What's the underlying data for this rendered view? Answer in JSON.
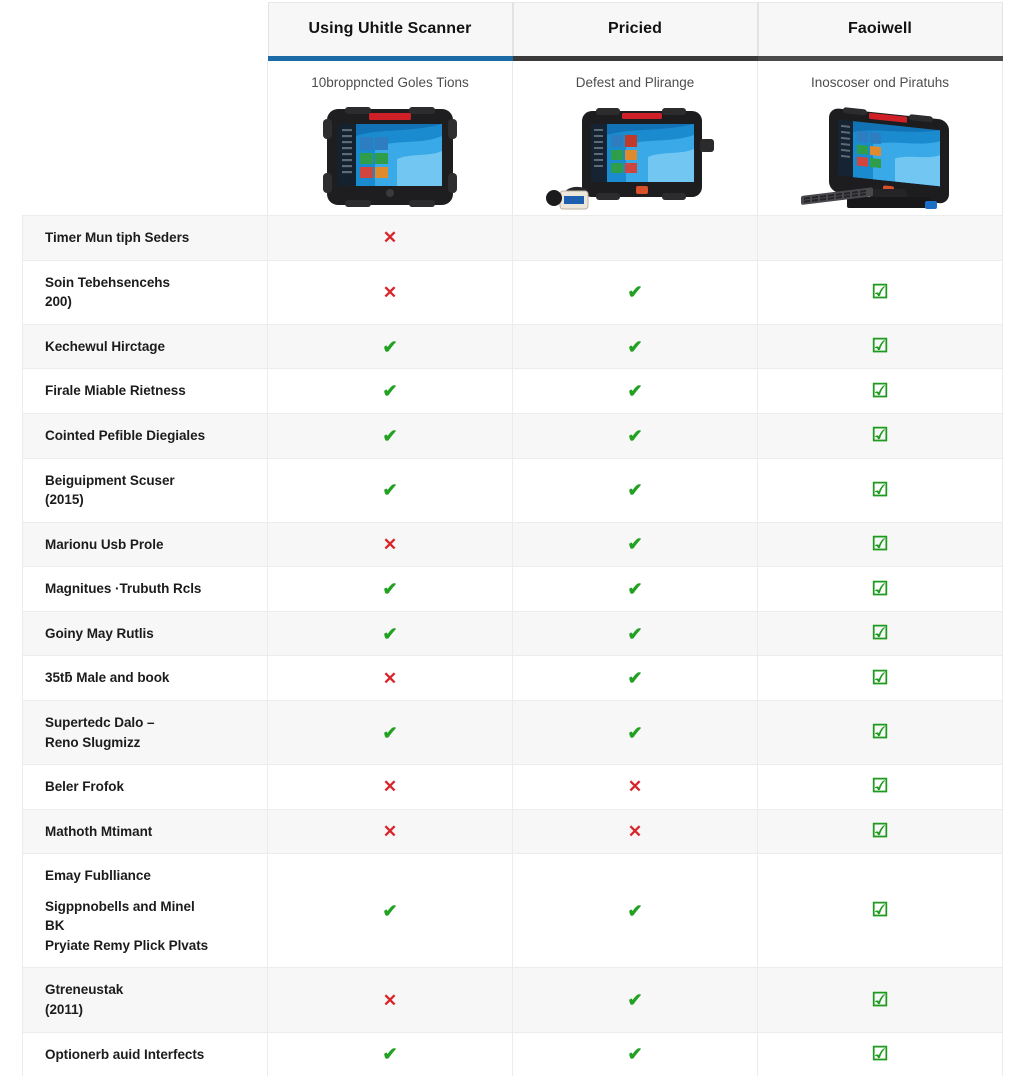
{
  "table": {
    "corner_header": "",
    "columns": [
      {
        "title": "Using Uhitle Scanner",
        "subtitle": "10broppncted Goles Tions",
        "accent_color": "#1a6ba8",
        "product_image": "rugged-tablet-front"
      },
      {
        "title": "Pricied",
        "subtitle": "Defest and Plirange",
        "accent_color": "#3a3a3a",
        "product_image": "rugged-tablet-with-scanner"
      },
      {
        "title": "Faoiwell",
        "subtitle": "Inoscoser ond Piratuhs",
        "accent_color": "#4a4a4a",
        "product_image": "rugged-panel-pc-with-keyboard"
      }
    ],
    "marks": {
      "yes": "✔",
      "no": "✕",
      "boxed_yes": "☑",
      "none": ""
    },
    "mark_colors": {
      "yes": "#22a122",
      "no": "#d8252b",
      "boxed_yes": "#1e9b1e"
    },
    "rows": [
      {
        "label": "Timer Mun tiph Seders",
        "label_lines": [
          "Timer Mun tiph Seders"
        ],
        "cells": [
          "no",
          "none",
          "none"
        ]
      },
      {
        "label": "Soin Tebehsencehs 200)",
        "label_lines": [
          "Soin Tebehsencehs",
          "200)"
        ],
        "cells": [
          "no",
          "yes",
          "boxed_yes"
        ]
      },
      {
        "label": "Kechewul Hirctage",
        "label_lines": [
          "Kechewul Hirctage"
        ],
        "cells": [
          "yes",
          "yes",
          "boxed_yes"
        ]
      },
      {
        "label": "Firale Miable Rietness",
        "label_lines": [
          "Firale Miable Rietness"
        ],
        "cells": [
          "yes",
          "yes",
          "boxed_yes"
        ]
      },
      {
        "label": "Cointed Pefible Diegiales",
        "label_lines": [
          "Cointed Pefible Diegiales"
        ],
        "cells": [
          "yes",
          "yes",
          "boxed_yes"
        ]
      },
      {
        "label": "Beiguipment Scuser (2015)",
        "label_lines": [
          "Beiguipment Scuser",
          "(2015)"
        ],
        "cells": [
          "yes",
          "yes",
          "boxed_yes"
        ]
      },
      {
        "label": "Marionu Usb Prole",
        "label_lines": [
          "Marionu Usb Prole"
        ],
        "cells": [
          "no",
          "yes",
          "boxed_yes"
        ]
      },
      {
        "label": "Magnitues Trubuth Rcls",
        "label_lines": [
          "Magnitues ·Trubuth Rcls"
        ],
        "cells": [
          "yes",
          "yes",
          "boxed_yes"
        ]
      },
      {
        "label": "Goiny May Rutlis",
        "label_lines": [
          "Goiny May Rutlis"
        ],
        "cells": [
          "yes",
          "yes",
          "boxed_yes"
        ]
      },
      {
        "label": "35tb Male and book",
        "label_lines": [
          "35tƃ Male and book"
        ],
        "cells": [
          "no",
          "yes",
          "boxed_yes"
        ]
      },
      {
        "label": "Superted Dalo - Reno Slugmizz",
        "label_lines": [
          "Supertedc Dalo –",
          "Reno Slugmizz"
        ],
        "cells": [
          "yes",
          "yes",
          "boxed_yes"
        ]
      },
      {
        "label": "Beler Frofok",
        "label_lines": [
          "Beler Frofok"
        ],
        "cells": [
          "no",
          "no",
          "boxed_yes"
        ]
      },
      {
        "label": "Mathoth Mtimant",
        "label_lines": [
          "Mathoth Mtimant"
        ],
        "cells": [
          "no",
          "no",
          "boxed_yes"
        ]
      },
      {
        "label": "Emay Fublliance / Sigppnobells and Minel BK / Pryiate Remy Plick Plvats",
        "label_lines": [
          "Emay Fublliance",
          "",
          "Sigppnobells and Minel",
          "BK",
          "Pryiate Remy Plick Plvats"
        ],
        "cells": [
          "yes",
          "yes",
          "boxed_yes"
        ]
      },
      {
        "label": "Gtreneustak (2011)",
        "label_lines": [
          "Gtreneustak",
          "(2011)"
        ],
        "cells": [
          "no",
          "yes",
          "boxed_yes"
        ]
      },
      {
        "label": "Optionerb auid Interfects",
        "label_lines": [
          "Optionerb auid Interfects"
        ],
        "cells": [
          "yes",
          "yes",
          "boxed_yes"
        ]
      }
    ]
  }
}
